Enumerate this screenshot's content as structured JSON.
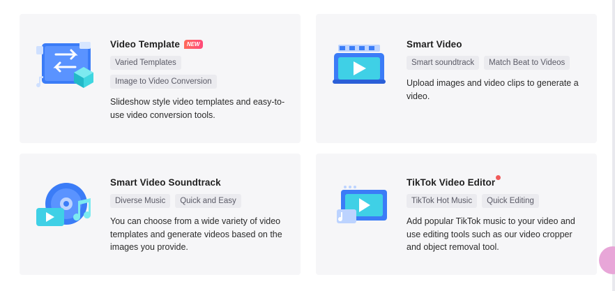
{
  "cards": [
    {
      "title": "Video Template",
      "badge": "NEW",
      "tags": [
        "Varied Templates",
        "Image to Video Conversion"
      ],
      "description": "Slideshow style video templates and easy-to-use video conversion tools.",
      "icon": "video-template-illustration"
    },
    {
      "title": "Smart Video",
      "tags": [
        "Smart soundtrack",
        "Match Beat to Videos"
      ],
      "description": "Upload images and video clips to generate a video.",
      "icon": "smart-video-illustration"
    },
    {
      "title": "Smart Video Soundtrack",
      "tags": [
        "Diverse Music",
        "Quick and Easy"
      ],
      "description": "You can choose from a wide variety of video templates and generate videos based on the images you provide.",
      "icon": "soundtrack-illustration"
    },
    {
      "title": "TikTok Video Editor",
      "tags": [
        "TikTok Hot Music",
        "Quick Editing"
      ],
      "description": "Add popular TikTok music to your video and use editing tools such as our video cropper and object removal tool.",
      "icon": "tiktok-editor-illustration"
    }
  ],
  "colors": {
    "card_bg": "#f6f6f8",
    "tag_bg": "#ebebef",
    "accent_blue": "#2f6df6",
    "badge_red": "#ff5a6a"
  }
}
